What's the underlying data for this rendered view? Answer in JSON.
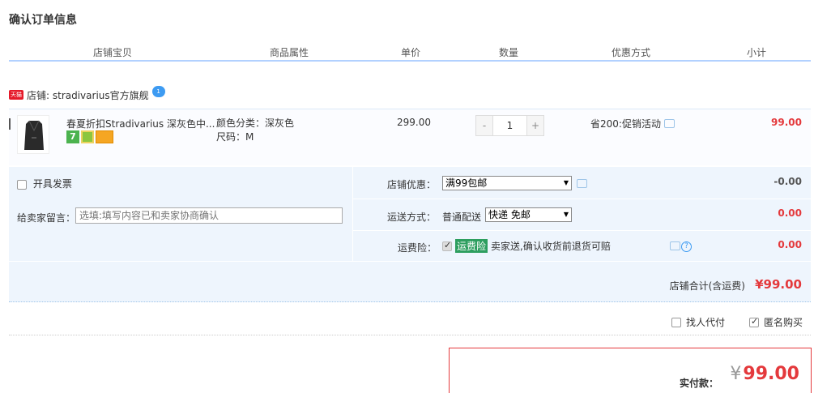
{
  "page": {
    "title": "确认订单信息"
  },
  "columns": [
    "店铺宝贝",
    "商品属性",
    "单价",
    "数量",
    "优惠方式",
    "小计"
  ],
  "shop": {
    "badge": "天猫",
    "label": "店铺: stradivarius官方旗舰",
    "chat_badge": "1"
  },
  "item": {
    "title": "春夏折扣Stradivarius 深灰色中...",
    "badge_7": "7",
    "attr_color": "颜色分类：深灰色",
    "attr_size": "尺码：M",
    "price": "299.00",
    "quantity": "1",
    "qty_minus": "-",
    "qty_plus": "+",
    "promotion": "省200:促销活动",
    "subtotal": "99.00"
  },
  "options": {
    "invoice_label": "开具发票",
    "message_label": "给卖家留言：",
    "message_placeholder": "选填:填写内容已和卖家协商确认",
    "shop_discount_label": "店铺优惠：",
    "shop_discount_value": "满99包邮",
    "shop_discount_amount": "-0.00",
    "shipping_label": "运送方式：",
    "shipping_method": "普通配送",
    "shipping_value": "快递 免邮",
    "shipping_amount": "0.00",
    "insurance_label": "运费险：",
    "insurance_tag": "运费险",
    "insurance_text": "卖家送,确认收货前退货可赔",
    "insurance_amount": "0.00",
    "help_glyph": "?"
  },
  "shop_total": {
    "label": "店铺合计(含运费)",
    "amount": "¥99.00"
  },
  "footer_options": {
    "pay_for_me": "找人代付",
    "anonymous": "匿名购买"
  },
  "payment": {
    "label": "实付款：",
    "currency": "¥",
    "amount": "99.00"
  },
  "colors": {
    "accent_red": "#e4393c",
    "panel_blue": "#eef5fd",
    "line_blue": "#b2d1ff"
  }
}
